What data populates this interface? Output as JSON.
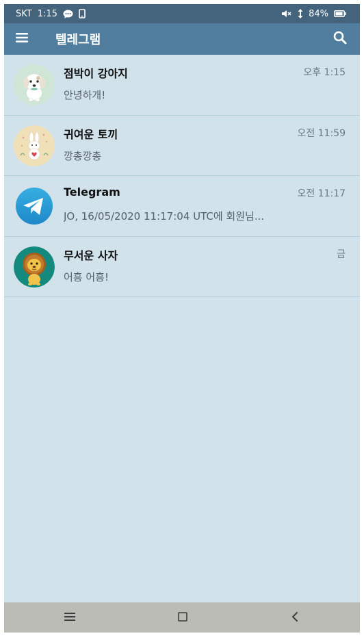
{
  "status_bar": {
    "carrier": "SKT",
    "time": "1:15",
    "battery": "84%",
    "icons": [
      "chat-bubble-icon",
      "phone-device-icon",
      "mute-icon",
      "data-transfer-icon",
      "battery-icon"
    ]
  },
  "app_bar": {
    "title": "텔레그램",
    "icons": [
      "hamburger-menu-icon",
      "search-icon"
    ]
  },
  "chats": [
    {
      "name": "점박이 강아지",
      "time": "오후 1:15",
      "message": "안녕하개!",
      "avatar": "puppy-avatar",
      "avatar_bg": "#cfe6d6"
    },
    {
      "name": "귀여운 토끼",
      "time": "오전 11:59",
      "message": "깡총깡총",
      "avatar": "bunny-avatar",
      "avatar_bg": "#f0e0b8"
    },
    {
      "name": "Telegram",
      "time": "오전 11:17",
      "message": "JO, 16/05/2020 11:17:04 UTC에 회원님...",
      "avatar": "telegram-logo-avatar",
      "avatar_bg": "#2a9bd8"
    },
    {
      "name": "무서운 사자",
      "time": "금",
      "message": "어흥 어흥!",
      "avatar": "lion-avatar",
      "avatar_bg": "#138a7d"
    }
  ],
  "nav_bar": {
    "icons": [
      "recent-apps-icon",
      "home-icon",
      "back-icon"
    ]
  },
  "colors": {
    "status_bar": "#44637d",
    "app_bar": "#517e9e",
    "list_background": "#d1e2eb",
    "divider": "#b6d0de",
    "nav_bar": "#bcbcb6"
  }
}
